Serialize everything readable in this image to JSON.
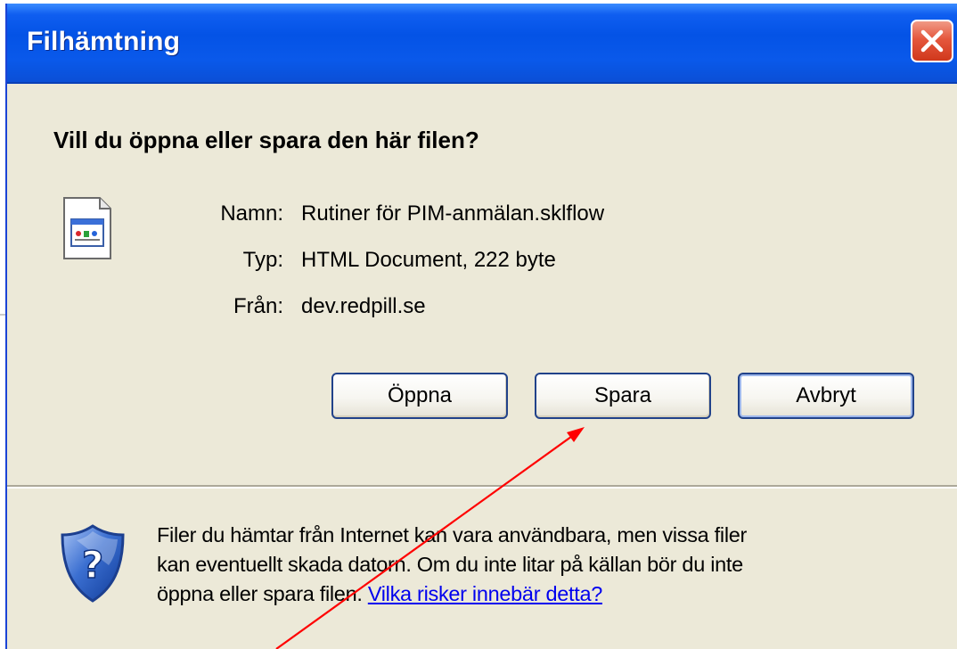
{
  "window": {
    "title": "Filhämtning"
  },
  "dialog": {
    "question": "Vill du öppna eller spara den här filen?",
    "file": {
      "name_label": "Namn:",
      "name_value": "Rutiner för PIM-anmälan.sklflow",
      "type_label": "Typ:",
      "type_value": "HTML Document, 222 byte",
      "from_label": "Från:",
      "from_value": "dev.redpill.se"
    },
    "buttons": {
      "open": "Öppna",
      "save": "Spara",
      "cancel": "Avbryt"
    },
    "warning": {
      "line1": "Filer du hämtar från Internet kan vara användbara, men vissa filer",
      "line2": "kan eventuellt skada datorn. Om du inte litar på källan bör du inte",
      "line3": "öppna eller spara filen.",
      "link": "Vilka risker innebär detta?"
    }
  },
  "icons": {
    "close": "close-icon",
    "file": "html-document-icon",
    "shield": "security-shield-icon"
  },
  "colors": {
    "titlebar": "#0453e6",
    "dialog_bg": "#ece9d8",
    "close_button": "#e5573d",
    "annotation_arrow": "#ff0000",
    "link": "#0000ee"
  }
}
